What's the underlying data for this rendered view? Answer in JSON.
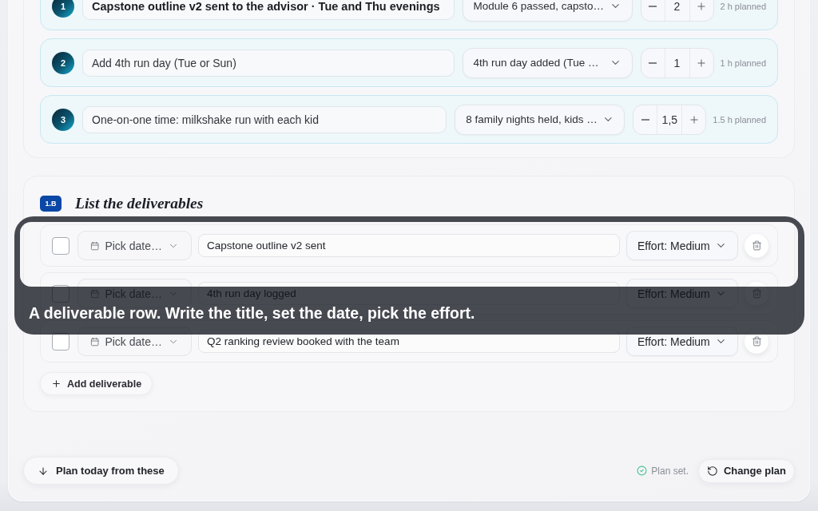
{
  "goals": {
    "rows": [
      {
        "number": "1",
        "title": "Capstone outline v2 sent to the advisor · Tue and Thu evenings",
        "primary": true,
        "outcome": "Module 6 passed, capsto…",
        "hours": "2",
        "planned": "2 h planned"
      },
      {
        "number": "2",
        "title": "Add 4th run day (Tue or Sun)",
        "primary": false,
        "outcome": "4th run day added (Tue …",
        "hours": "1",
        "planned": "1 h planned"
      },
      {
        "number": "3",
        "title": "One-on-one time: milkshake run with each kid",
        "primary": false,
        "outcome": "8 family nights held, kids …",
        "hours": "1,5",
        "planned": "1.5 h planned"
      }
    ]
  },
  "deliverables": {
    "badge": "1.B",
    "title": "List the deliverables",
    "rows": [
      {
        "checked": false,
        "date": "Pick date…",
        "title": "Capstone outline v2 sent",
        "effort": "Effort: Medium",
        "spotlighted": true
      },
      {
        "checked": false,
        "date": "Pick date…",
        "title": "4th run day logged",
        "effort": "Effort: Medium",
        "spotlighted": false
      },
      {
        "checked": false,
        "date": "Pick date…",
        "title": "Q2 ranking review booked with the team",
        "effort": "Effort: Medium",
        "spotlighted": false
      }
    ],
    "add_button": "Add deliverable"
  },
  "tour": {
    "text": "A deliverable row. Write the title, set the date, pick the effort."
  },
  "footer": {
    "plan_button": "Plan today from these",
    "status": "Plan set.",
    "change_button": "Change plan"
  }
}
